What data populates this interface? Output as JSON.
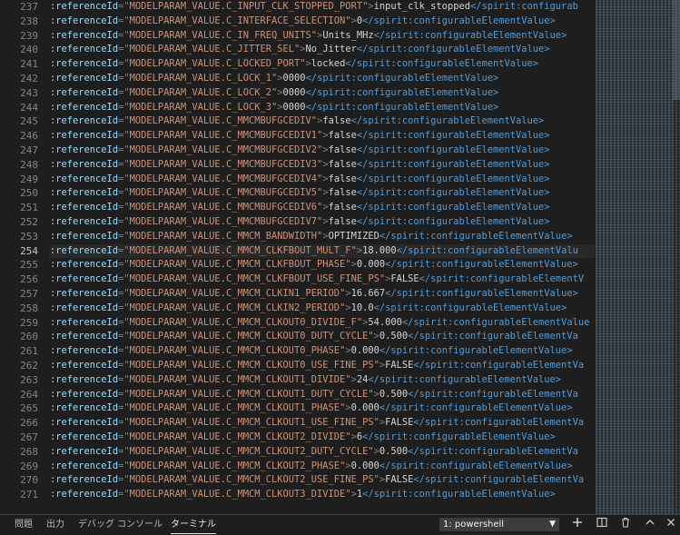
{
  "editor": {
    "current_line": 254,
    "lines": [
      {
        "num": "237",
        "param": "MODELPARAM_VALUE.C_INPUT_CLK_STOPPED_PORT",
        "value": "input_clk_stopped",
        "close": "</spirit:configurab"
      },
      {
        "num": "238",
        "param": "MODELPARAM_VALUE.C_INTERFACE_SELECTION",
        "value": "0",
        "close": "</spirit:configurableElementValue>"
      },
      {
        "num": "239",
        "param": "MODELPARAM_VALUE.C_IN_FREQ_UNITS",
        "value": "Units_MHz",
        "close": "</spirit:configurableElementValue>"
      },
      {
        "num": "240",
        "param": "MODELPARAM_VALUE.C_JITTER_SEL",
        "value": "No_Jitter",
        "close": "</spirit:configurableElementValue>"
      },
      {
        "num": "241",
        "param": "MODELPARAM_VALUE.C_LOCKED_PORT",
        "value": "locked",
        "close": "</spirit:configurableElementValue>"
      },
      {
        "num": "242",
        "param": "MODELPARAM_VALUE.C_LOCK_1",
        "value": "0000",
        "close": "</spirit:configurableElementValue>"
      },
      {
        "num": "243",
        "param": "MODELPARAM_VALUE.C_LOCK_2",
        "value": "0000",
        "close": "</spirit:configurableElementValue>"
      },
      {
        "num": "244",
        "param": "MODELPARAM_VALUE.C_LOCK_3",
        "value": "0000",
        "close": "</spirit:configurableElementValue>"
      },
      {
        "num": "245",
        "param": "MODELPARAM_VALUE.C_MMCMBUFGCEDIV",
        "value": "false",
        "close": "</spirit:configurableElementValue>"
      },
      {
        "num": "246",
        "param": "MODELPARAM_VALUE.C_MMCMBUFGCEDIV1",
        "value": "false",
        "close": "</spirit:configurableElementValue>"
      },
      {
        "num": "247",
        "param": "MODELPARAM_VALUE.C_MMCMBUFGCEDIV2",
        "value": "false",
        "close": "</spirit:configurableElementValue>"
      },
      {
        "num": "248",
        "param": "MODELPARAM_VALUE.C_MMCMBUFGCEDIV3",
        "value": "false",
        "close": "</spirit:configurableElementValue>"
      },
      {
        "num": "249",
        "param": "MODELPARAM_VALUE.C_MMCMBUFGCEDIV4",
        "value": "false",
        "close": "</spirit:configurableElementValue>"
      },
      {
        "num": "250",
        "param": "MODELPARAM_VALUE.C_MMCMBUFGCEDIV5",
        "value": "false",
        "close": "</spirit:configurableElementValue>"
      },
      {
        "num": "251",
        "param": "MODELPARAM_VALUE.C_MMCMBUFGCEDIV6",
        "value": "false",
        "close": "</spirit:configurableElementValue>"
      },
      {
        "num": "252",
        "param": "MODELPARAM_VALUE.C_MMCMBUFGCEDIV7",
        "value": "false",
        "close": "</spirit:configurableElementValue>"
      },
      {
        "num": "253",
        "param": "MODELPARAM_VALUE.C_MMCM_BANDWIDTH",
        "value": "OPTIMIZED",
        "close": "</spirit:configurableElementValue>"
      },
      {
        "num": "254",
        "param": "MODELPARAM_VALUE.C_MMCM_CLKFBOUT_MULT_F",
        "value": "18.000",
        "close": "</spirit:configurableElementValu"
      },
      {
        "num": "255",
        "param": "MODELPARAM_VALUE.C_MMCM_CLKFBOUT_PHASE",
        "value": "0.000",
        "close": "</spirit:configurableElementValue>"
      },
      {
        "num": "256",
        "param": "MODELPARAM_VALUE.C_MMCM_CLKFBOUT_USE_FINE_PS",
        "value": "FALSE",
        "close": "</spirit:configurableElementV"
      },
      {
        "num": "257",
        "param": "MODELPARAM_VALUE.C_MMCM_CLKIN1_PERIOD",
        "value": "16.667",
        "close": "</spirit:configurableElementValue>"
      },
      {
        "num": "258",
        "param": "MODELPARAM_VALUE.C_MMCM_CLKIN2_PERIOD",
        "value": "10.0",
        "close": "</spirit:configurableElementValue>"
      },
      {
        "num": "259",
        "param": "MODELPARAM_VALUE.C_MMCM_CLKOUT0_DIVIDE_F",
        "value": "54.000",
        "close": "</spirit:configurableElementValue"
      },
      {
        "num": "260",
        "param": "MODELPARAM_VALUE.C_MMCM_CLKOUT0_DUTY_CYCLE",
        "value": "0.500",
        "close": "</spirit:configurableElementVa"
      },
      {
        "num": "261",
        "param": "MODELPARAM_VALUE.C_MMCM_CLKOUT0_PHASE",
        "value": "0.000",
        "close": "</spirit:configurableElementValue>"
      },
      {
        "num": "262",
        "param": "MODELPARAM_VALUE.C_MMCM_CLKOUT0_USE_FINE_PS",
        "value": "FALSE",
        "close": "</spirit:configurableElementVa"
      },
      {
        "num": "263",
        "param": "MODELPARAM_VALUE.C_MMCM_CLKOUT1_DIVIDE",
        "value": "24",
        "close": "</spirit:configurableElementValue>"
      },
      {
        "num": "264",
        "param": "MODELPARAM_VALUE.C_MMCM_CLKOUT1_DUTY_CYCLE",
        "value": "0.500",
        "close": "</spirit:configurableElementVa"
      },
      {
        "num": "265",
        "param": "MODELPARAM_VALUE.C_MMCM_CLKOUT1_PHASE",
        "value": "0.000",
        "close": "</spirit:configurableElementValue>"
      },
      {
        "num": "266",
        "param": "MODELPARAM_VALUE.C_MMCM_CLKOUT1_USE_FINE_PS",
        "value": "FALSE",
        "close": "</spirit:configurableElementVa"
      },
      {
        "num": "267",
        "param": "MODELPARAM_VALUE.C_MMCM_CLKOUT2_DIVIDE",
        "value": "6",
        "close": "</spirit:configurableElementValue>"
      },
      {
        "num": "268",
        "param": "MODELPARAM_VALUE.C_MMCM_CLKOUT2_DUTY_CYCLE",
        "value": "0.500",
        "close": "</spirit:configurableElementVa"
      },
      {
        "num": "269",
        "param": "MODELPARAM_VALUE.C_MMCM_CLKOUT2_PHASE",
        "value": "0.000",
        "close": "</spirit:configurableElementValue>"
      },
      {
        "num": "270",
        "param": "MODELPARAM_VALUE.C_MMCM_CLKOUT2_USE_FINE_PS",
        "value": "FALSE",
        "close": "</spirit:configurableElementVa"
      },
      {
        "num": "271",
        "param": "MODELPARAM_VALUE.C_MMCM_CLKOUT3_DIVIDE",
        "value": "1",
        "close": "</spirit:configurableElementValue>"
      }
    ]
  },
  "panel": {
    "tabs": [
      "問題",
      "出力",
      "デバッグ コンソール",
      "ターミナル"
    ],
    "active_tab": "ターミナル",
    "terminal_select": "1: powershell",
    "icons": [
      "add-terminal-icon",
      "split-terminal-icon",
      "trash-icon",
      "chevron-up-icon",
      "close-icon"
    ]
  }
}
